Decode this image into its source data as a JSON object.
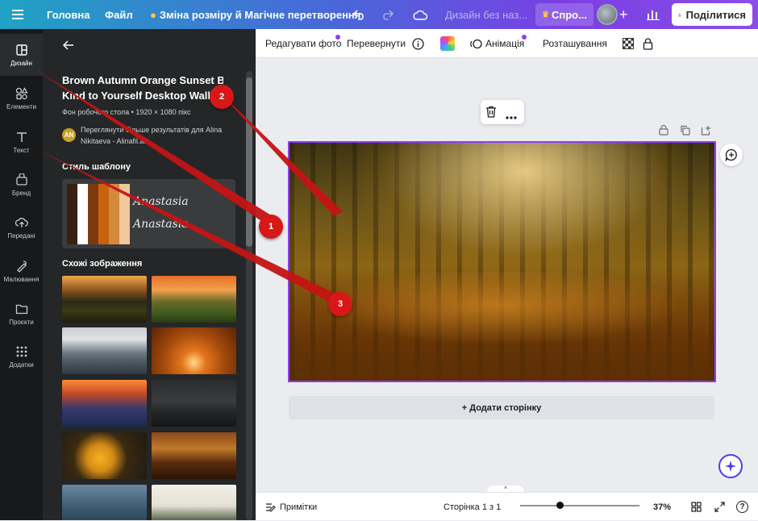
{
  "topbar": {
    "menu_icon": "hamburger-icon",
    "home": "Головна",
    "file": "Файл",
    "resize": "Зміна розміру й Магічне перетворення",
    "design_name": "Дизайн без наз...",
    "upgrade": "Спро...",
    "share": "Поділитися"
  },
  "rail": {
    "items": [
      {
        "label": "Дизайн",
        "icon": "layout-icon"
      },
      {
        "label": "Елементи",
        "icon": "shapes-icon"
      },
      {
        "label": "Текст",
        "icon": "text-icon"
      },
      {
        "label": "Бренд",
        "icon": "brand-icon"
      },
      {
        "label": "Передані",
        "icon": "upload-icon"
      },
      {
        "label": "Малювання",
        "icon": "draw-icon"
      },
      {
        "label": "Проєкти",
        "icon": "folder-icon"
      },
      {
        "label": "Додатки",
        "icon": "apps-icon"
      }
    ]
  },
  "panel": {
    "title_line1": "Brown Autumn Orange Sunset Be",
    "title_line2": "Kind to Yourself Desktop Wallpa",
    "meta": "Фон робочого стола • 1920 × 1080 пікс",
    "author_initials": "AN",
    "author_line1": "Переглянути більше результатів для Alina",
    "author_line2": "Nikitaeva - Alinafil.art",
    "style_heading": "Стиль шаблону",
    "script_text": "Anastasia",
    "similar_heading": "Схожі зображення",
    "palette": [
      "#3a1f14",
      "#ffffff",
      "#7a3a10",
      "#c8620f",
      "#d48a3c",
      "#f0c89a"
    ]
  },
  "context_toolbar": {
    "edit_photo": "Редагувати фото",
    "flip": "Перевернути",
    "animation": "Анімація",
    "position": "Розташування"
  },
  "canvas": {
    "add_page": "+ Додати сторінку"
  },
  "bottombar": {
    "notes": "Примітки",
    "page": "Сторінка 1 з 1",
    "zoom": "37%",
    "help": "?"
  },
  "markers": [
    "1",
    "2",
    "3"
  ],
  "colors": {
    "accent": "#8b3dff",
    "marker": "#d81818"
  }
}
